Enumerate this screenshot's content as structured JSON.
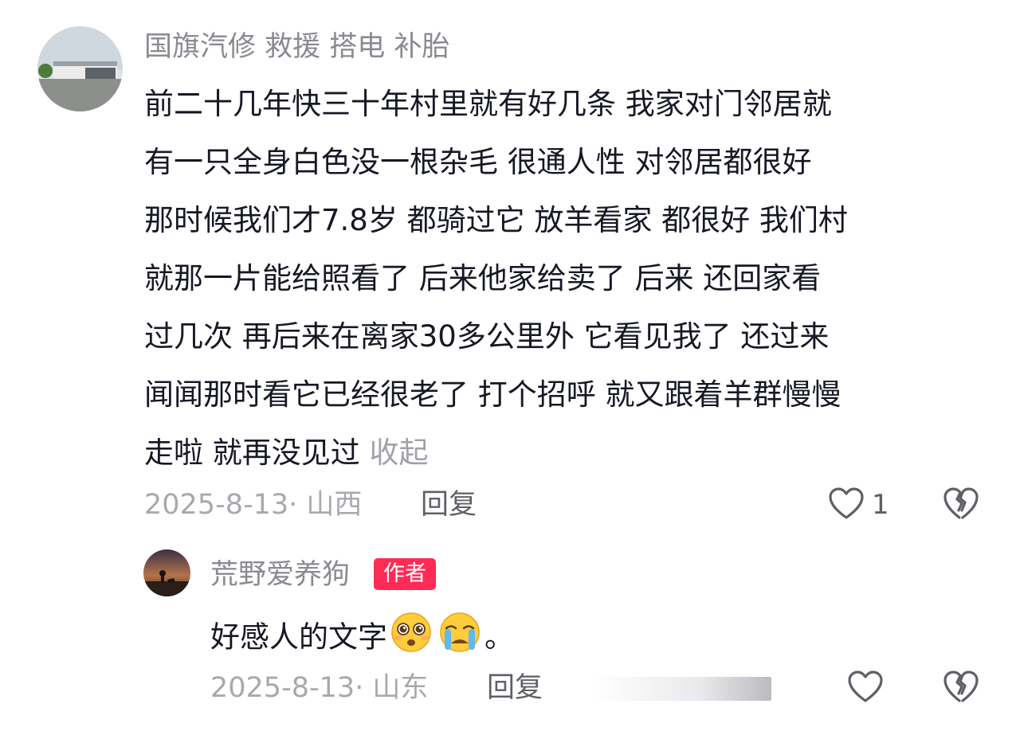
{
  "comment": {
    "username": "国旗汽修 救援  搭电  补胎",
    "lines": [
      "前二十几年快三十年村里就有好几条   我家对门邻居就",
      "有一只全身白色没一根杂毛  很通人性 对邻居都很好",
      "那时候我们才7.8岁  都骑过它  放羊看家 都很好 我们村",
      "就那一片能给照看了 后来他家给卖了   后来 还回家看",
      "过几次  再后来在离家30多公里外  它看见我了  还过来",
      "闻闻那时看它已经很老了 打个招呼  就又跟着羊群慢慢",
      "走啦  就再没见过"
    ],
    "collapse_label": "收起",
    "meta": "2025-8-13· 山西",
    "reply_label": "回复",
    "like_count": "1",
    "icons": {
      "like": "heart-outline-icon",
      "dislike": "broken-heart-icon"
    }
  },
  "reply": {
    "username": "荒野爱养狗",
    "badge": "作者",
    "text": "好感人的文字",
    "emojis": [
      "pleading-face-emoji",
      "crying-face-emoji"
    ],
    "text_end": "。",
    "meta": "2025-8-13· 山东",
    "reply_label": "回复",
    "icons": {
      "like": "heart-outline-icon",
      "dislike": "broken-heart-icon"
    }
  },
  "colors": {
    "badge": "#fe2c55",
    "muted": "#a8a9ae",
    "text": "#161823"
  }
}
